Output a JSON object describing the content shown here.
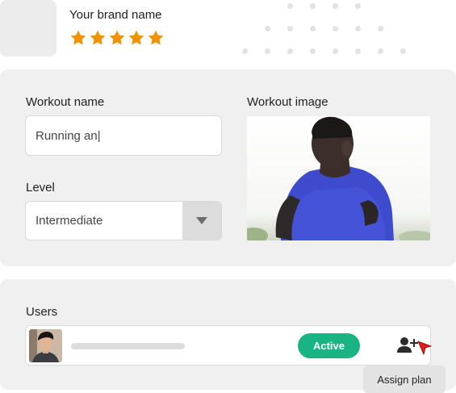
{
  "brand": {
    "name": "Your brand name",
    "rating": 5,
    "rating_max": 5,
    "star_color": "#f39200"
  },
  "form": {
    "workout_name_label": "Workout name",
    "workout_name_value": "Running an|",
    "level_label": "Level",
    "level_value": "Intermediate",
    "workout_image_label": "Workout image"
  },
  "users": {
    "label": "Users",
    "rows": [
      {
        "status": "Active",
        "status_color": "#18b483"
      }
    ],
    "assign_tooltip": "Assign plan"
  },
  "colors": {
    "card_bg": "#f0f0f0",
    "cursor": "#e31b1b"
  }
}
